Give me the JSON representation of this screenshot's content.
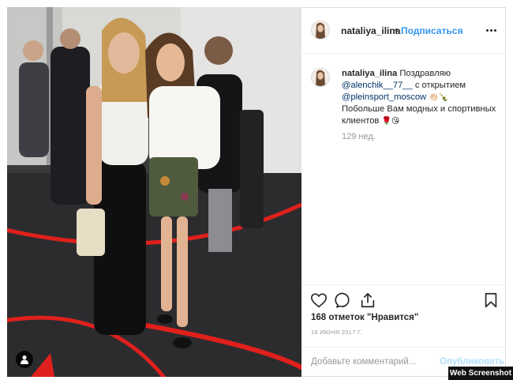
{
  "post": {
    "photo_alt": "",
    "username": "nataliya_ilina",
    "dot": "•",
    "follow_label": "Подписаться",
    "more_icon": "more-horizontal-icon",
    "caption": {
      "username": "nataliya_ilina",
      "text_1": "Поздравляю",
      "mention_1": "@alenchik__77__",
      "text_2": "с открытием",
      "mention_2": "@pleinsport_moscow",
      "emoji_1": "👏🏻🍾",
      "text_3": "Побольше Вам модных и спортивных клиентов",
      "emoji_2": "🌹😘"
    },
    "age": "129 нед.",
    "actions": [
      "heart-icon",
      "comment-icon",
      "share-icon",
      "bookmark-icon"
    ],
    "likes": "168 отметок \"Нравится\"",
    "date": "16 ИЮНЯ 2017 Г.",
    "comment_placeholder": "Добавьте комментарий...",
    "publish_label": "Опубликовать"
  },
  "watermark": "Web Screenshot",
  "colors": {
    "accent": "#3897f0",
    "link": "#003569",
    "muted": "#999999",
    "publish_disabled": "#b2dffc",
    "floor_stripe": "#e0201c"
  }
}
